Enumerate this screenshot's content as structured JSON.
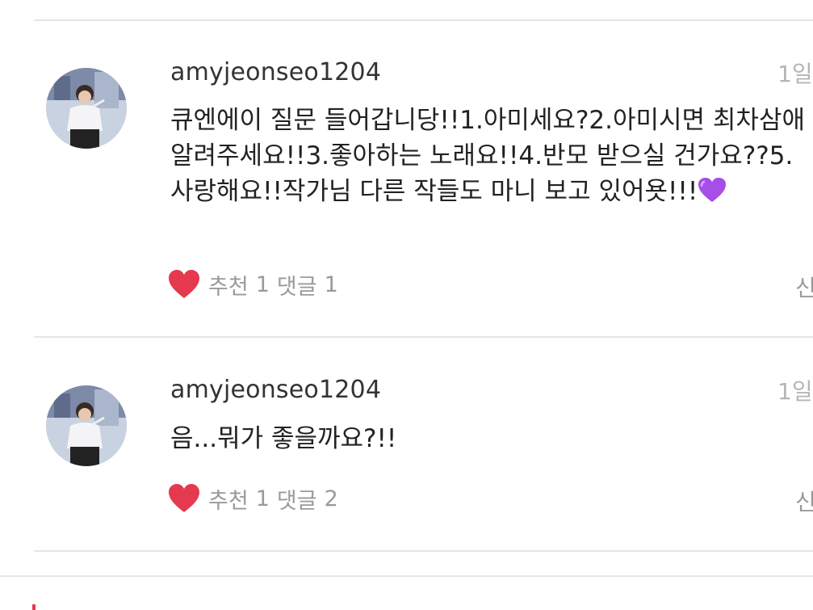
{
  "comments": [
    {
      "username": "amyjeonseo1204",
      "time": "1일",
      "text": "큐엔에이 질문 들어갑니당!!1.아미세요?2.아미시면 최차삼애 알려주세요!!3.좋아하는 노래요!!4.반모 받으실 건가요??5.사랑해요!!작가님 다른 작들도 마니 보고 있어욧!!!",
      "emoji": "purple-heart",
      "like_label": "추천",
      "like_count": "1",
      "reply_label": "댓글",
      "reply_count": "1",
      "report_label": "신"
    },
    {
      "username": "amyjeonseo1204",
      "time": "1일",
      "text": "음...뭐가 좋을까요?!!",
      "like_label": "추천",
      "like_count": "1",
      "reply_label": "댓글",
      "reply_count": "2",
      "report_label": "신"
    }
  ],
  "colors": {
    "heart": "#e53950",
    "emoji_purple": "#a64ee8",
    "meta_gray": "#9a9a9a",
    "time_gray": "#b5b5b5",
    "divider": "#e6e6e6"
  }
}
